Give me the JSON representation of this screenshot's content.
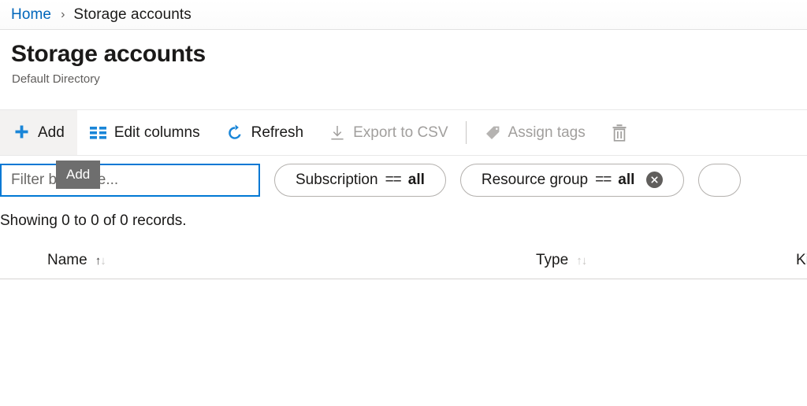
{
  "breadcrumb": {
    "home_label": "Home",
    "separator": "›",
    "current_label": "Storage accounts"
  },
  "header": {
    "title": "Storage accounts",
    "subtitle": "Default Directory"
  },
  "toolbar": {
    "items": [
      {
        "label": "Add",
        "icon": "plus-icon",
        "state": "hovered"
      },
      {
        "label": "Edit columns",
        "icon": "columns-icon",
        "state": "enabled"
      },
      {
        "label": "Refresh",
        "icon": "refresh-icon",
        "state": "enabled"
      },
      {
        "label": "Export to CSV",
        "icon": "download-icon",
        "state": "disabled"
      },
      {
        "label": "Assign tags",
        "icon": "tag-icon",
        "state": "disabled"
      },
      {
        "label": "",
        "icon": "trash-icon",
        "state": "disabled"
      }
    ],
    "tooltip": "Add"
  },
  "filters": {
    "name_filter_placeholder": "Filter by name...",
    "name_filter_value": "",
    "pills": [
      {
        "field": "Subscription",
        "operator": "==",
        "value": "all",
        "clearable": false
      },
      {
        "field": "Resource group",
        "operator": "==",
        "value": "all",
        "clearable": true
      },
      {
        "field": "",
        "operator": "",
        "value": "",
        "clearable": false
      }
    ]
  },
  "records_summary": "Showing 0 to 0 of 0 records.",
  "table": {
    "columns": [
      {
        "label": "Name",
        "sort": "asc"
      },
      {
        "label": "Type",
        "sort": "none"
      },
      {
        "label": "Kind",
        "sort": "none"
      }
    ],
    "rows": []
  },
  "colors": {
    "accent": "#0078d4",
    "link": "#0066bb",
    "disabled_text": "#a19f9d",
    "tooltip_bg": "#6e6e6e"
  }
}
